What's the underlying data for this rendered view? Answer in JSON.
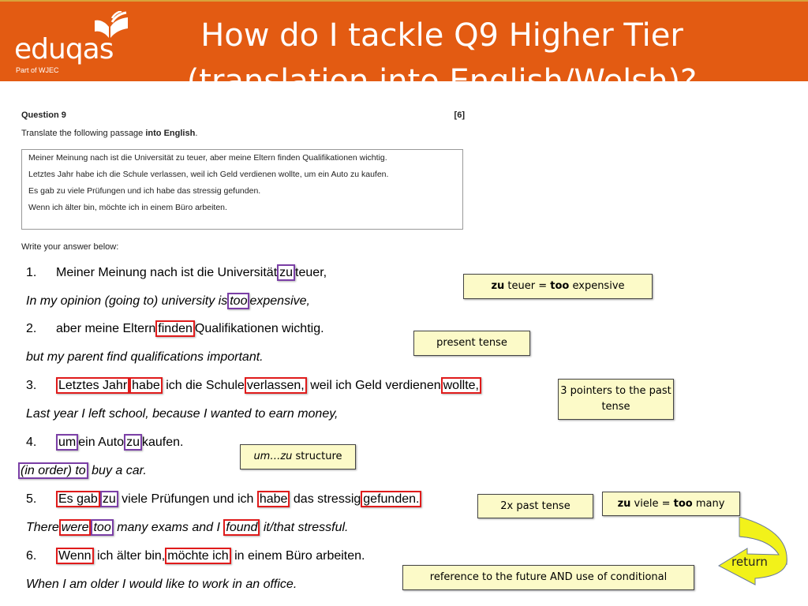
{
  "header": {
    "logo_text": "eduqas",
    "logo_sub": "Part of WJEC",
    "title_line1": "How do I tackle Q9 Higher Tier",
    "title_line2": "(translation into English/Welsh)?",
    "bg_color": "#e35b12"
  },
  "exam": {
    "question_label": "Question 9",
    "marks": "[6]",
    "instruction_prefix": "Translate the following passage ",
    "instruction_bold": "into English",
    "instruction_suffix": ".",
    "passage": [
      "Meiner Meinung nach ist die Universität zu teuer, aber meine Eltern finden Qualifikationen wichtig.",
      "Letztes Jahr habe ich die Schule verlassen, weil ich Geld verdienen wollte, um ein Auto zu kaufen.",
      "Es gab zu viele Prüfungen und ich habe das stressig gefunden.",
      "Wenn ich älter bin, möchte ich in einem Büro arbeiten."
    ],
    "answer_prompt": "Write your answer below:"
  },
  "lines": {
    "l1": {
      "num": "1.",
      "a": "Meiner Meinung nach ist die Universität",
      "h1": "zu",
      "b": "teuer,"
    },
    "t1": {
      "a": "In my opinion (going to) university is",
      "h1": "too",
      "b": "expensive,"
    },
    "l2": {
      "num": "2.",
      "a": "aber meine Eltern",
      "h1": "finden",
      "b": "Qualifikationen wichtig."
    },
    "t2": {
      "a": "but my parent find qualifications important."
    },
    "l3": {
      "num": "3.",
      "h1": "Letztes Jahr",
      "h2": "habe",
      "a": "ich die Schule",
      "h3": "verlassen,",
      "b": "weil ich Geld verdienen",
      "h4": "wollte,"
    },
    "t3": {
      "a": "Last year I left school, because I wanted to earn money,"
    },
    "l4": {
      "num": "4.",
      "h1": "um",
      "a": "ein Auto",
      "h2": "zu",
      "b": "kaufen."
    },
    "t4": {
      "h1": "(in order) to",
      "a": "buy a car."
    },
    "l5": {
      "num": "5.",
      "h1": "Es gab",
      "h2": "zu",
      "a": "viele Prüfungen und ich",
      "h3": "habe",
      "b": "das stressig",
      "h4": "gefunden."
    },
    "t5": {
      "a": "There",
      "h1": "were",
      "h2": "too",
      "b": "many exams and I",
      "h3": "found",
      "c": "it/that stressful."
    },
    "l6": {
      "num": "6.",
      "h1": "Wenn",
      "a": "ich älter bin,",
      "h2": "möchte ich",
      "b": "in einem Büro arbeiten."
    },
    "t6": {
      "a": "When I am older I would like to work in an office."
    }
  },
  "notes": {
    "zu_teuer": {
      "b1": "zu",
      "a": " teuer = ",
      "b2": "too",
      "c": " expensive"
    },
    "present_tense": "present tense",
    "past_pointers": "3 pointers to the past tense",
    "um_zu_italic": "um…zu",
    "um_zu_rest": " structure",
    "two_past": "2x past tense",
    "zu_viele": {
      "b1": "zu",
      "a": " viele = ",
      "b2": "too",
      "c": " many"
    },
    "future": "reference to the future   AND   use of conditional"
  },
  "return_label": "return",
  "colors": {
    "red_highlight": "#e01b1b",
    "purple_highlight": "#7b3fa6",
    "note_bg": "#fcfac8",
    "arrow_yellow": "#f2f21a",
    "arrow_olive": "#c9c91a"
  }
}
